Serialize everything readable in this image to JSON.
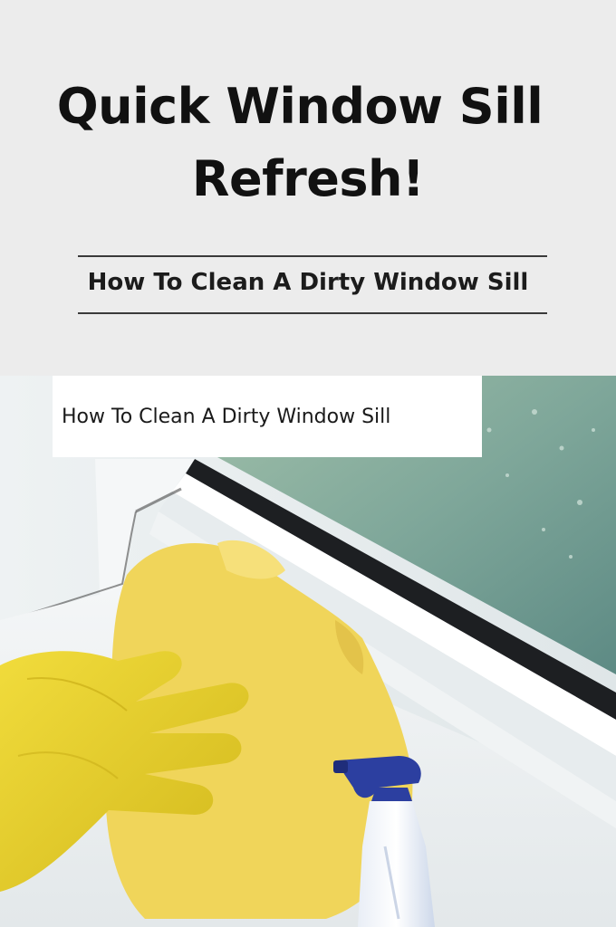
{
  "title": {
    "line1": "Quick Window Sill",
    "line2": "Refresh!"
  },
  "subtitle": "How To Clean A Dirty Window Sill",
  "caption": "How To Clean A Dirty Window Sill",
  "colors": {
    "background": "#ececec",
    "title": "#111111",
    "glove": "#e8cf2a",
    "cloth": "#f2d65a",
    "sprayer_head": "#2c3fa0",
    "window_glass": "#7fa89a"
  }
}
